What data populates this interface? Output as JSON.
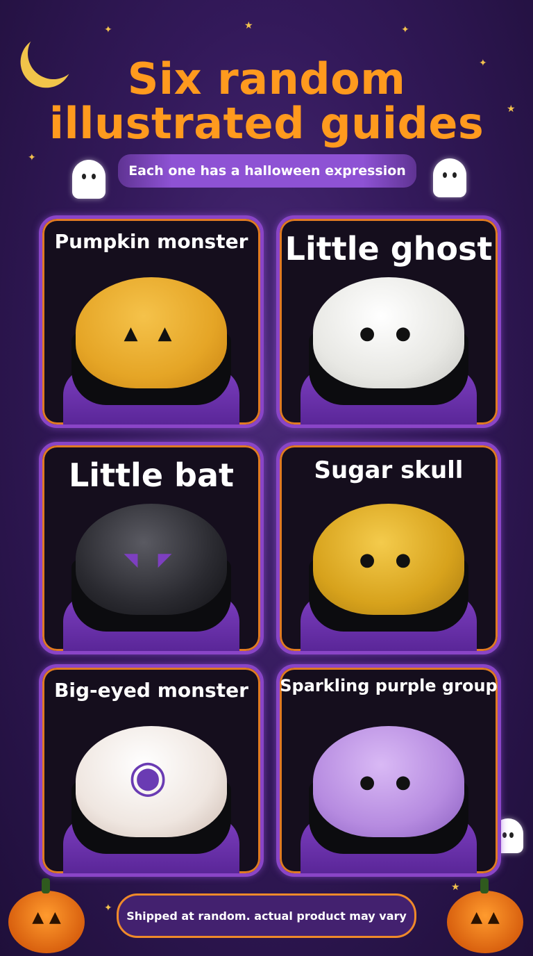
{
  "header": {
    "title_line1": "Six random",
    "title_line2": "illustrated guides",
    "subtitle": "Each one has a halloween expression"
  },
  "cards": [
    {
      "label": "Pumpkin monster",
      "dome_color": "#e5a526",
      "face": "▲ ▲"
    },
    {
      "label": "Little ghost",
      "dome_color": "#e8e8e4",
      "face": "● ●"
    },
    {
      "label": "Little bat",
      "dome_color": "#2a2a30",
      "face": "◥ ◤"
    },
    {
      "label": "Sugar skull",
      "dome_color": "#d7a21c",
      "face": "● ●"
    },
    {
      "label": "Big-eyed monster",
      "dome_color": "#efe6e0",
      "face": "◉"
    },
    {
      "label": "Sparkling purple group",
      "dome_color": "#b68be0",
      "face": "● ●"
    }
  ],
  "footer": {
    "note": "Shipped at random. actual product may vary"
  },
  "colors": {
    "title": "#ff9a1e",
    "accent_purple": "#8a45c7",
    "accent_orange": "#e07a22"
  },
  "icons": [
    "moon-icon",
    "ghost-icon",
    "pumpkin-icon",
    "star-icon"
  ]
}
